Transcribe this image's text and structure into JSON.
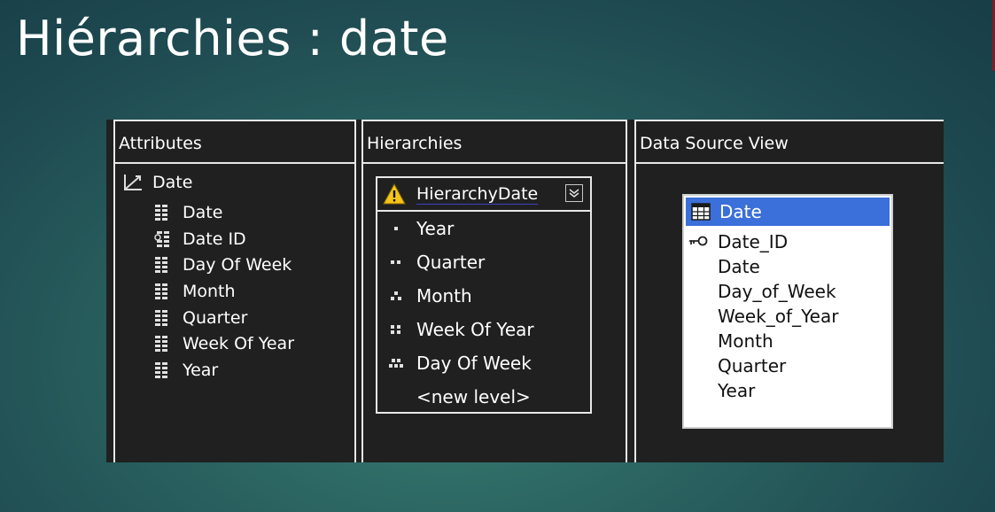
{
  "slide": {
    "title": "Hiérarchies : date"
  },
  "attributes_pane": {
    "header": "Attributes",
    "dimension": "Date",
    "items": [
      {
        "label": "Date",
        "icon": "attribute-icon"
      },
      {
        "label": "Date ID",
        "icon": "key-attribute-icon"
      },
      {
        "label": "Day Of Week",
        "icon": "attribute-icon"
      },
      {
        "label": "Month",
        "icon": "attribute-icon"
      },
      {
        "label": "Quarter",
        "icon": "attribute-icon"
      },
      {
        "label": "Week Of Year",
        "icon": "attribute-icon"
      },
      {
        "label": "Year",
        "icon": "attribute-icon"
      }
    ]
  },
  "hierarchies_pane": {
    "header": "Hierarchies",
    "hierarchy": {
      "name": "HierarchyDate",
      "levels": [
        "Year",
        "Quarter",
        "Month",
        "Week Of Year",
        "Day Of Week"
      ],
      "new_level": "<new level>"
    }
  },
  "dsv_pane": {
    "header": "Data Source View",
    "table": {
      "name": "Date",
      "columns": [
        "Date_ID",
        "Date",
        "Day_of_Week",
        "Week_of_Year",
        "Month",
        "Quarter",
        "Year"
      ]
    }
  },
  "colors": {
    "selection": "#3b6fd9",
    "pane_bg": "#202020",
    "warning": "#f5c518"
  }
}
